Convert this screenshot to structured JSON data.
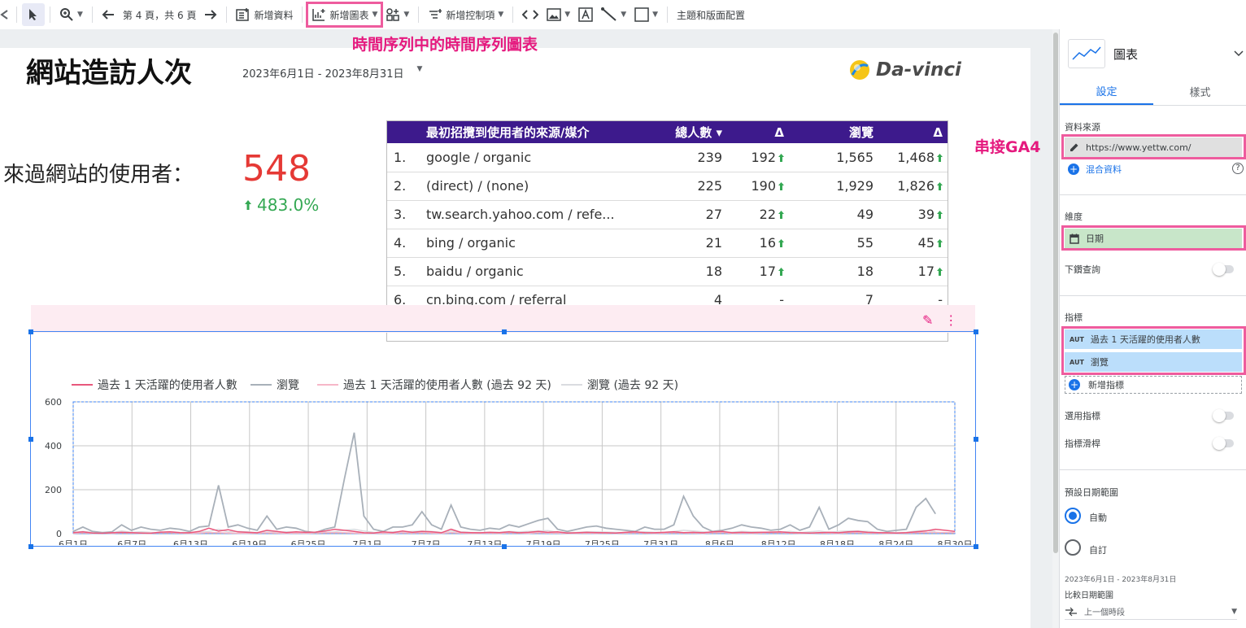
{
  "toolbar": {
    "page_nav": "第 4 頁，共 6 頁",
    "add_data": "新增資料",
    "add_chart": "新增圖表",
    "add_control": "新增控制項",
    "theme_layout": "主題和版面配置"
  },
  "annotations": {
    "chart_type": "時間序列中的時間序列圖表",
    "ga4": "串接GA4"
  },
  "report": {
    "title": "網站造訪人次",
    "date_range": "2023年6月1日 - 2023年8月31日",
    "logo_text": "Da-vinci",
    "scorecard": {
      "label": "來過網站的使用者：",
      "value": "548",
      "delta": "483.0%"
    }
  },
  "table": {
    "headers": [
      "最初招攬到使用者的來源/媒介",
      "總人數 ▾",
      "Δ",
      "瀏覽",
      "Δ"
    ],
    "rows": [
      {
        "idx": "1.",
        "source": "google / organic",
        "users": "239",
        "users_delta": "192",
        "views": "1,565",
        "views_delta": "1,468"
      },
      {
        "idx": "2.",
        "source": "(direct) / (none)",
        "users": "225",
        "users_delta": "190",
        "views": "1,929",
        "views_delta": "1,826"
      },
      {
        "idx": "3.",
        "source": "tw.search.yahoo.com / refe...",
        "users": "27",
        "users_delta": "22",
        "views": "49",
        "views_delta": "39"
      },
      {
        "idx": "4.",
        "source": "bing / organic",
        "users": "21",
        "users_delta": "16",
        "views": "55",
        "views_delta": "45"
      },
      {
        "idx": "5.",
        "source": "baidu / organic",
        "users": "18",
        "users_delta": "17",
        "views": "18",
        "views_delta": "17"
      },
      {
        "idx": "6.",
        "source": "cn.bing.com / referral",
        "users": "4",
        "users_delta": "-",
        "views": "7",
        "views_delta": "-"
      }
    ]
  },
  "chart_data": {
    "type": "line",
    "x_ticks": [
      "6月1日",
      "6月7日",
      "6月13日",
      "6月19日",
      "6月25日",
      "7月1日",
      "7月7日",
      "7月13日",
      "7月19日",
      "7月25日",
      "7月31日",
      "8月6日",
      "8月12日",
      "8月18日",
      "8月24日",
      "8月30日"
    ],
    "ylim": [
      0,
      600
    ],
    "y_ticks": [
      "0",
      "200",
      "400",
      "600"
    ],
    "series": [
      {
        "name": "過去 1 天活躍的使用者人數",
        "color": "#e8577c",
        "values": [
          5,
          8,
          3,
          2,
          4,
          6,
          5,
          3,
          2,
          7,
          8,
          5,
          4,
          10,
          25,
          12,
          18,
          8,
          6,
          4,
          15,
          10,
          5,
          8,
          6,
          7,
          12,
          20,
          15,
          10,
          4,
          3,
          8,
          5,
          12,
          6,
          10,
          8,
          4,
          20,
          6,
          5,
          4,
          6,
          5,
          8,
          4,
          6,
          10,
          6,
          8,
          3,
          4,
          6,
          5,
          4,
          3,
          6,
          8,
          5,
          4,
          6,
          8,
          5,
          6,
          4,
          8,
          10,
          4,
          6,
          5,
          6,
          7,
          8,
          5,
          4,
          3,
          5,
          6,
          4,
          8,
          10,
          6,
          5,
          4,
          3,
          5,
          8,
          12,
          20,
          15,
          10
        ]
      },
      {
        "name": "瀏覽",
        "color": "#a8b0b9",
        "values": [
          10,
          30,
          10,
          5,
          8,
          40,
          15,
          30,
          20,
          15,
          25,
          20,
          10,
          30,
          35,
          220,
          30,
          40,
          25,
          15,
          80,
          20,
          30,
          25,
          10,
          5,
          20,
          30,
          250,
          460,
          80,
          20,
          10,
          30,
          30,
          40,
          100,
          40,
          20,
          130,
          30,
          20,
          15,
          25,
          20,
          40,
          30,
          45,
          60,
          70,
          20,
          10,
          20,
          30,
          35,
          25,
          20,
          15,
          10,
          30,
          20,
          20,
          40,
          170,
          80,
          30,
          10,
          15,
          25,
          40,
          30,
          25,
          15,
          20,
          40,
          15,
          30,
          120,
          20,
          40,
          70,
          60,
          55,
          20,
          10,
          15,
          20,
          120,
          160,
          90
        ]
      },
      {
        "name": "過去 1 天活躍的使用者人數 (過去 92 天)",
        "color": "#f6b7c8",
        "values": [
          2,
          4,
          2,
          3,
          2,
          4,
          3,
          2,
          2,
          5,
          4,
          3,
          2,
          3,
          5,
          4,
          3,
          2,
          2,
          3,
          4,
          3,
          2,
          3,
          2,
          3,
          4,
          5,
          4,
          3,
          2,
          2,
          3,
          2,
          4,
          3,
          4,
          3,
          2,
          5,
          3,
          2,
          2,
          3,
          2,
          4,
          3,
          2,
          4,
          3,
          3,
          2,
          2,
          3,
          2,
          3,
          2,
          3,
          4,
          3,
          2,
          3,
          4,
          3,
          3,
          2,
          4,
          5,
          2,
          3,
          2,
          3,
          4,
          4,
          3,
          2,
          2,
          3,
          3,
          2,
          4,
          5,
          3,
          3,
          2,
          2,
          3,
          4,
          5,
          6,
          5,
          4
        ]
      },
      {
        "name": "瀏覽 (過去 92 天)",
        "color": "#dadce0",
        "values": [
          5,
          10,
          6,
          4,
          5,
          12,
          6,
          8,
          6,
          5,
          8,
          6,
          5,
          8,
          10,
          20,
          8,
          10,
          8,
          5,
          12,
          6,
          8,
          7,
          5,
          4,
          6,
          8,
          15,
          20,
          12,
          6,
          5,
          8,
          8,
          10,
          12,
          10,
          6,
          12,
          8,
          6,
          5,
          7,
          6,
          10,
          8,
          10,
          12,
          14,
          6,
          5,
          6,
          8,
          8,
          7,
          6,
          5,
          4,
          8,
          6,
          6,
          10,
          15,
          12,
          8,
          4,
          5,
          7,
          10,
          8,
          7,
          5,
          6,
          10,
          5,
          8,
          12,
          6,
          10,
          12,
          12,
          10,
          6,
          4,
          5,
          6,
          12,
          15,
          10
        ]
      }
    ]
  },
  "panel": {
    "chart_type_label": "圖表",
    "tab_setup": "設定",
    "tab_style": "樣式",
    "datasource_label": "資料來源",
    "datasource_value": "https://www.yettw.com/",
    "blend_label": "混合資料",
    "dimension_label": "維度",
    "dimension_value": "日期",
    "drilldown_label": "下鑽查詢",
    "metric_label": "指標",
    "metric_1": "過去 1 天活躍的使用者人數",
    "metric_2": "瀏覽",
    "metric_badge": "AUT",
    "add_metric": "新增指標",
    "optional_metric": "選用指標",
    "metric_slider": "指標滑桿",
    "default_date_label": "預設日期範圍",
    "auto_label": "自動",
    "custom_label": "自訂",
    "date_range_small": "2023年6月1日 - 2023年8月31日",
    "compare_label": "比較日期範圍",
    "compare_value": "上一個時段"
  }
}
